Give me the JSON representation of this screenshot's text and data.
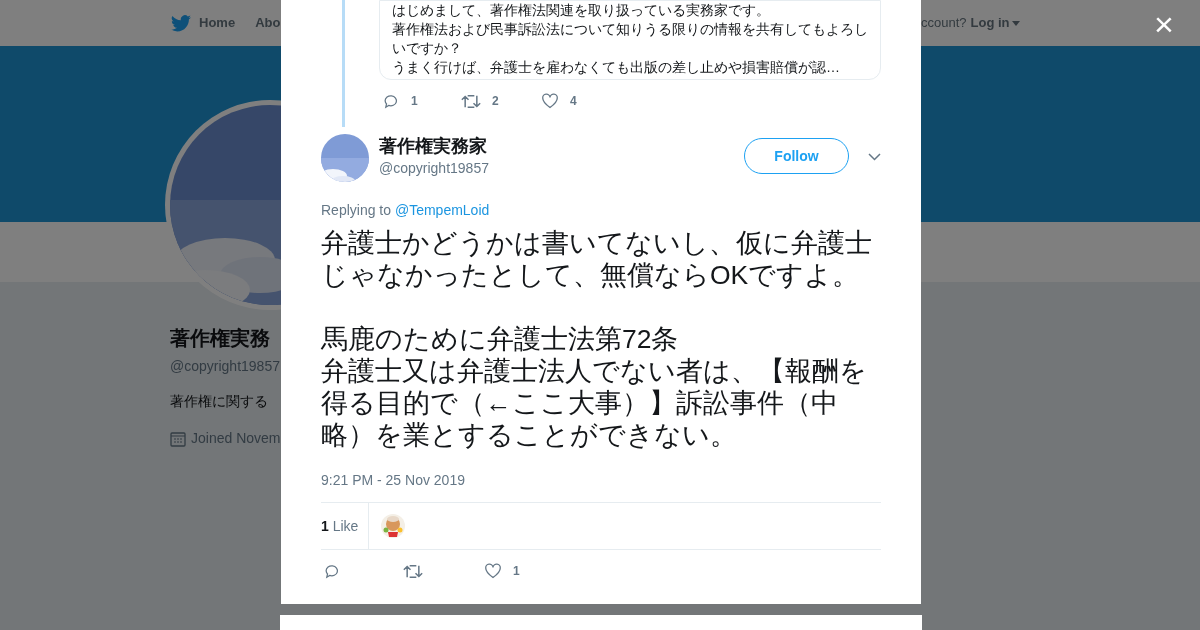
{
  "background_page": {
    "nav": {
      "home": "Home",
      "about": "Abo",
      "account": "ccount?",
      "login": "Log in"
    },
    "profile": {
      "name": "著作権実務",
      "handle": "@copyright19857",
      "bio": "著作権に関する",
      "joined": "Joined Novem"
    }
  },
  "modal": {
    "close": "×",
    "quoted_tweet": {
      "lines": [
        "はじめまして、著作権法関連を取り扱っている実務家です。",
        "著作権法および民事訴訟法について知りうる限りの情報を共有してもよろし",
        "いですか？",
        "うまく行けば、弁護士を雇わなくても出版の差し止めや損害賠償が認…"
      ],
      "replies": "1",
      "retweets": "2",
      "likes": "4"
    },
    "tweet": {
      "name": "著作権実務家",
      "handle": "@copyright19857",
      "follow": "Follow",
      "replying_label": "Replying to",
      "replying_to": "@TempemLoid",
      "text": [
        "弁護士かどうかは書いてないし、仮に弁護士じゃなかったとして、無償ならOKですよ。",
        "馬鹿のために弁護士法第72条",
        "弁護士又は弁護士法人でない者は、【報酬を得る目的で（←ここ大事）】訴訟事件（中略）を業とすることができない。"
      ],
      "time": "9:21 PM - 25 Nov 2019",
      "like_count": "1",
      "like_label": "Like",
      "likes": "1"
    }
  }
}
